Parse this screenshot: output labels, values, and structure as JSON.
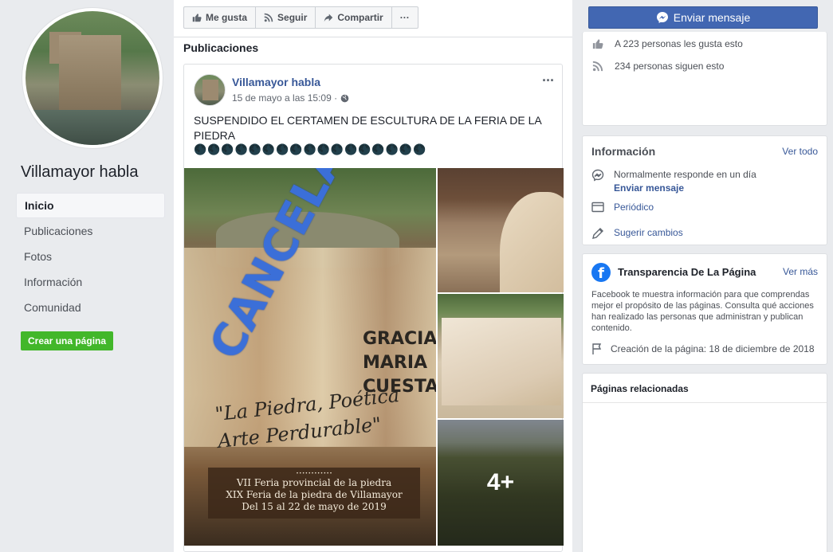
{
  "sidebar": {
    "page_name": "Villamayor habla",
    "nav": [
      "Inicio",
      "Publicaciones",
      "Fotos",
      "Información",
      "Comunidad"
    ],
    "create_page": "Crear una página"
  },
  "actions": {
    "like": "Me gusta",
    "follow": "Seguir",
    "share": "Compartir",
    "more": "···"
  },
  "feed": {
    "section_title": "Publicaciones",
    "post": {
      "author": "Villamayor habla",
      "time": "15 de mayo a las 15:09 ·",
      "more": "···",
      "text": "SUSPENDIDO EL CERTAMEN DE ESCULTURA DE LA FERIA DE LA PIEDRA",
      "emojis": "🌑🌑🌑🌑🌑🌑🌑🌑🌑🌑🌑🌑🌑🌑🌑🌑🌑",
      "image": {
        "stamp": "CANCELADA",
        "gracias": "GRACIAS\nMARIA\nCUESTA",
        "quote": "\"La Piedra, Poética\nArte Perdurable\"",
        "footer_dots": "············",
        "footer_line1": "VII Feria provincial de la piedra",
        "footer_line2": "XIX Feria de la piedra de Villamayor",
        "footer_line3": "Del 15 al 22 de mayo de 2019"
      },
      "more_photos": "4+"
    }
  },
  "right": {
    "send_message": "Enviar mensaje",
    "likes": "A 223 personas les gusta esto",
    "follows": "234 personas siguen esto",
    "info": {
      "title": "Información",
      "see_all": "Ver todo",
      "response": "Normalmente responde en un día",
      "send_message_link": "Enviar mensaje",
      "category": "Periódico",
      "suggest": "Sugerir cambios"
    },
    "transparency": {
      "logo": "f",
      "title": "Transparencia De La Página",
      "see_more": "Ver más",
      "body": "Facebook te muestra información para que comprendas mejor el propósito de las páginas. Consulta qué acciones han realizado las personas que administran y publican contenido.",
      "creation": "Creación de la página: 18 de diciembre de 2018"
    },
    "related_title": "Páginas relacionadas"
  },
  "colors": {
    "fb_blue": "#4267b2",
    "link_blue": "#385898",
    "green_button": "#42b72a",
    "cancel_stamp": "#3b6fd8"
  }
}
